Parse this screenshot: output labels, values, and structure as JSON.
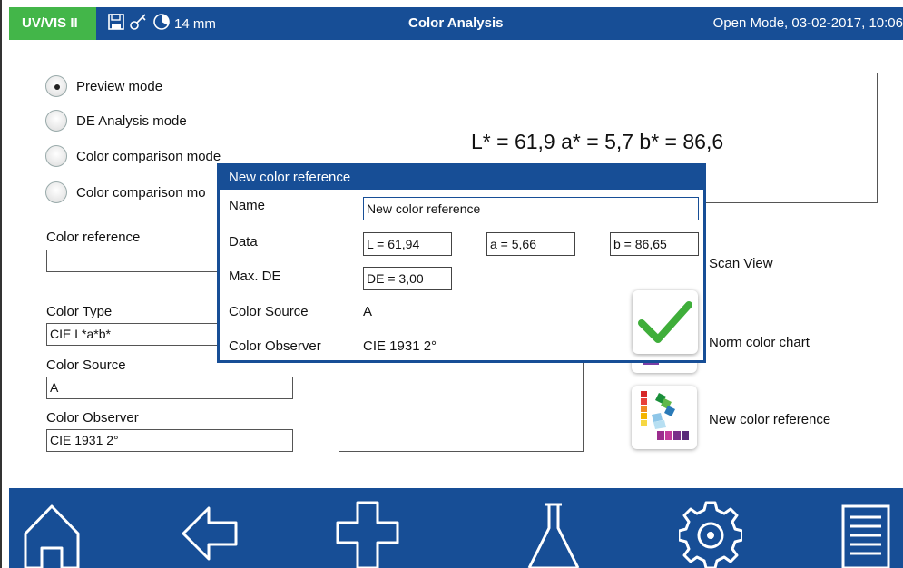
{
  "header": {
    "app_name": "UV/VIS II",
    "cell_size": "14 mm",
    "title": "Color Analysis",
    "mode_datetime": "Open Mode, 03-02-2017, 10:06"
  },
  "modes": [
    {
      "label": "Preview mode",
      "selected": true
    },
    {
      "label": "DE Analysis mode",
      "selected": false
    },
    {
      "label": "Color comparison mode",
      "selected": false
    },
    {
      "label": "Color comparison mo",
      "selected": false
    }
  ],
  "left_panel": {
    "color_reference_label": "Color reference",
    "color_reference_value": "",
    "color_type_label": "Color Type",
    "color_type_value": "CIE L*a*b*",
    "color_source_label": "Color Source",
    "color_source_value": "A",
    "color_observer_label": "Color Observer",
    "color_observer_value": "CIE 1931 2°"
  },
  "result": {
    "text": "L* = 61,9 a* = 5,7 b* = 86,6"
  },
  "actions": {
    "scan_view": "Scan View",
    "norm_color_chart": "Norm color chart",
    "new_color_reference": "New color reference"
  },
  "dialog": {
    "title": "New color reference",
    "name_label": "Name",
    "name_value": "New color reference",
    "data_label": "Data",
    "data_l": "L = 61,94",
    "data_a": "a = 5,66",
    "data_b": "b = 86,65",
    "max_de_label": "Max. DE",
    "max_de_value": "DE = 3,00",
    "color_source_label": "Color Source",
    "color_source_value": "A",
    "color_observer_label": "Color Observer",
    "color_observer_value": "CIE 1931 2°"
  },
  "colors": {
    "header_blue": "#174e96",
    "badge_green": "#43b649",
    "check_green": "#3fae3a"
  },
  "icons": [
    "save-icon",
    "key-icon",
    "timer-icon",
    "check-icon",
    "palette-icon",
    "home-icon",
    "back-icon",
    "add-icon",
    "flask-icon",
    "settings-icon",
    "menu-icon"
  ]
}
